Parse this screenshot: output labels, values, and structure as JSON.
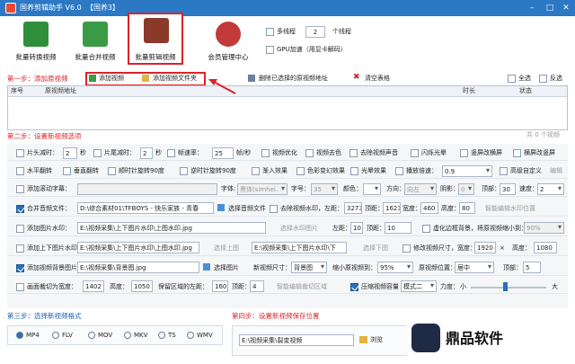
{
  "app": {
    "title": "国养剪辑助手 V6.0",
    "edition": "【国养3】"
  },
  "toolbar": {
    "batch_convert": "批量转换视频",
    "batch_merge": "批量合并视频",
    "batch_edit": "批量剪辑视频",
    "member_center": "会员管理中心",
    "multithread_label": "多线程",
    "thread_count": "2",
    "thread_unit": "个线程",
    "gpu_label": "GPU加速（用显卡解码）"
  },
  "step1": {
    "title": "第一步：添加原视频",
    "add_video": "添加视频",
    "add_folder": "添加视频文件夹",
    "delete_selected": "删除已选择的原视频地址",
    "clear_table": "清空表格",
    "select_all": "全选",
    "invert": "反选",
    "columns": [
      "序号",
      "原视频地址",
      "时长",
      "状态"
    ],
    "count": "共 0 个视频"
  },
  "step2": {
    "title": "第二步：设置新视频选项",
    "r1": {
      "head_cut": "片头减时：",
      "head_val": "2",
      "sec": "秒",
      "tail_cut": "片尾减时：",
      "tail_val": "2",
      "sec2": "秒",
      "fps": "帧速率：",
      "fps_val": "25",
      "fps_unit": "帧/秒",
      "optimize": "视频优化",
      "decolor": "视频去色",
      "mute": "去除视频声音",
      "flash": "闪烁光晕",
      "v2h": "竖屏改横屏",
      "h2v": "横屏改竖屏"
    },
    "r2": {
      "hflip": "水平翻转",
      "vflip": "垂直翻转",
      "rot_cw": "顺时针旋转90度",
      "rot_ccw": "逆时针旋转90度",
      "fade": "渐入效果",
      "color": "色彩变幻效果",
      "light": "光晕效果",
      "speed_label": "播放倍速：",
      "speed_val": "0.9",
      "advanced": "高级自定义",
      "edit": "编辑"
    },
    "r3": {
      "subtitle": "添加滚动字幕：",
      "font": "字体:",
      "font_val": "黑体(simhei.",
      "size": "字号：",
      "size_val": "35",
      "color": "颜色：",
      "direction": "方向：",
      "dir_val": "向左",
      "shadow": "阴影：",
      "shadow_val": "0",
      "top": "顶部：",
      "top_val": "30",
      "speed": "速度：",
      "speed_val": "2"
    },
    "r4": {
      "merge_audio": "合并音频文件：",
      "audio_path": "D:\\综合素材01\\TFBOYS - 快乐家族 - 青春",
      "pick_audio": "选择音频文件",
      "wm_remove": "去除视频水印，左距：",
      "left": "3273",
      "top_l": "顶距：",
      "top": "1623",
      "width_l": "宽度：",
      "width": "460",
      "height_l": "高度：",
      "height": "80",
      "smart": "智能编辑水印位置"
    },
    "r5": {
      "add_wm": "添加图片水印：",
      "wm_path": "E:\\视频采集\\上下图片水印\\上图水印.jpg",
      "pick_wm": "选择水印图片",
      "left_l": "左距：",
      "left": "10",
      "top_l": "顶距：",
      "top": "10",
      "blur": "虚化边框背景，将原视频缩小到：",
      "blur_val": "90%"
    },
    "r6": {
      "updown": "添加上下图片水印：",
      "up_path": "E:\\视频采集\\上下图片水印\\上图水印.jpg",
      "pick_up": "选择上图",
      "down_path": "E:\\视频采集\\上下图片水印\\下",
      "pick_down": "选择下图",
      "resize": "修改视频尺寸，宽度：",
      "w": "1920",
      "x": "×",
      "h_l": "高度：",
      "h": "1080"
    },
    "r7": {
      "bg": "添加视频背景图片：",
      "bg_path": "E:\\视频采集\\背景图.jpg",
      "pick_bg": "选择图片",
      "new_size": "新视频尺寸：",
      "size_val": "背景图",
      "shrink": "缩小原视频到：",
      "shrink_val": "95%",
      "pos": "原视频位置：",
      "pos_val": "居中",
      "top_l": "顶部：",
      "top": "5"
    },
    "r8": {
      "crop": "画面裁切为宽度：",
      "cw": "1402",
      "ch_l": "高度：",
      "ch": "1050",
      "keep": "保留区域的左距：",
      "kl": "160",
      "top_l": "顶距：",
      "kt": "4",
      "smart": "智能编辑裁切区域",
      "compress": "压缩视频容量",
      "mode": "模式二",
      "strength": "力度：",
      "small": "小",
      "large": "大"
    }
  },
  "step3": {
    "title": "第三步：选择新视频格式",
    "formats": [
      "MP4",
      "FLV",
      "MOV",
      "MKV",
      "TS",
      "WMV"
    ]
  },
  "step4": {
    "title": "第四步：设置新视频保存位置",
    "path": "E:\\视频采集\\裂变视频",
    "browse": "浏览"
  },
  "watermark": {
    "brand": "鼎品软件"
  },
  "colors": {
    "accent_red": "#d9232a",
    "title_blue": "#2b78c5"
  }
}
